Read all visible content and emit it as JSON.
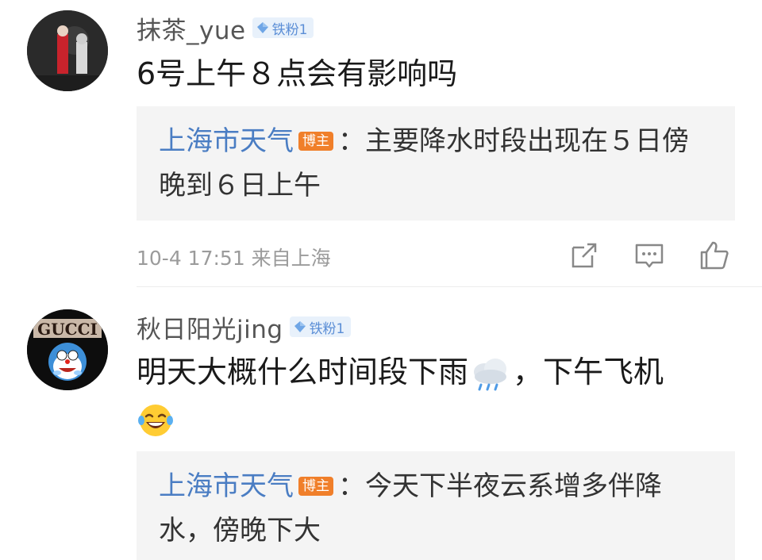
{
  "comments": [
    {
      "username": "抹茶_yue",
      "fan_badge": "铁粉1",
      "content": "6号上午８点会有影响吗",
      "reply": {
        "author": "上海市天气",
        "badge": "博主",
        "text": "：主要降水时段出现在５日傍晚到６日上午"
      },
      "timestamp": "10-4 17:51 来自上海",
      "actions": [
        "share-icon",
        "comment-icon",
        "like-icon"
      ]
    },
    {
      "username": "秋日阳光jing",
      "fan_badge": "铁粉1",
      "avatar_text": "GUCCI",
      "content_before": "明天大概什么时间段下雨",
      "content_after": "，下午飞机",
      "emojis": [
        "rain-cloud-emoji",
        "laughing-tears-emoji"
      ],
      "reply": {
        "author": "上海市天气",
        "badge": "博主",
        "text": "：今天下半夜云系增多伴降水，傍晚下大"
      }
    }
  ],
  "colors": {
    "link_blue": "#4a7dc3",
    "blogger_orange": "#f07f2a",
    "fan_badge_bg": "#e8f1fb",
    "reply_bg": "#f4f4f4"
  }
}
